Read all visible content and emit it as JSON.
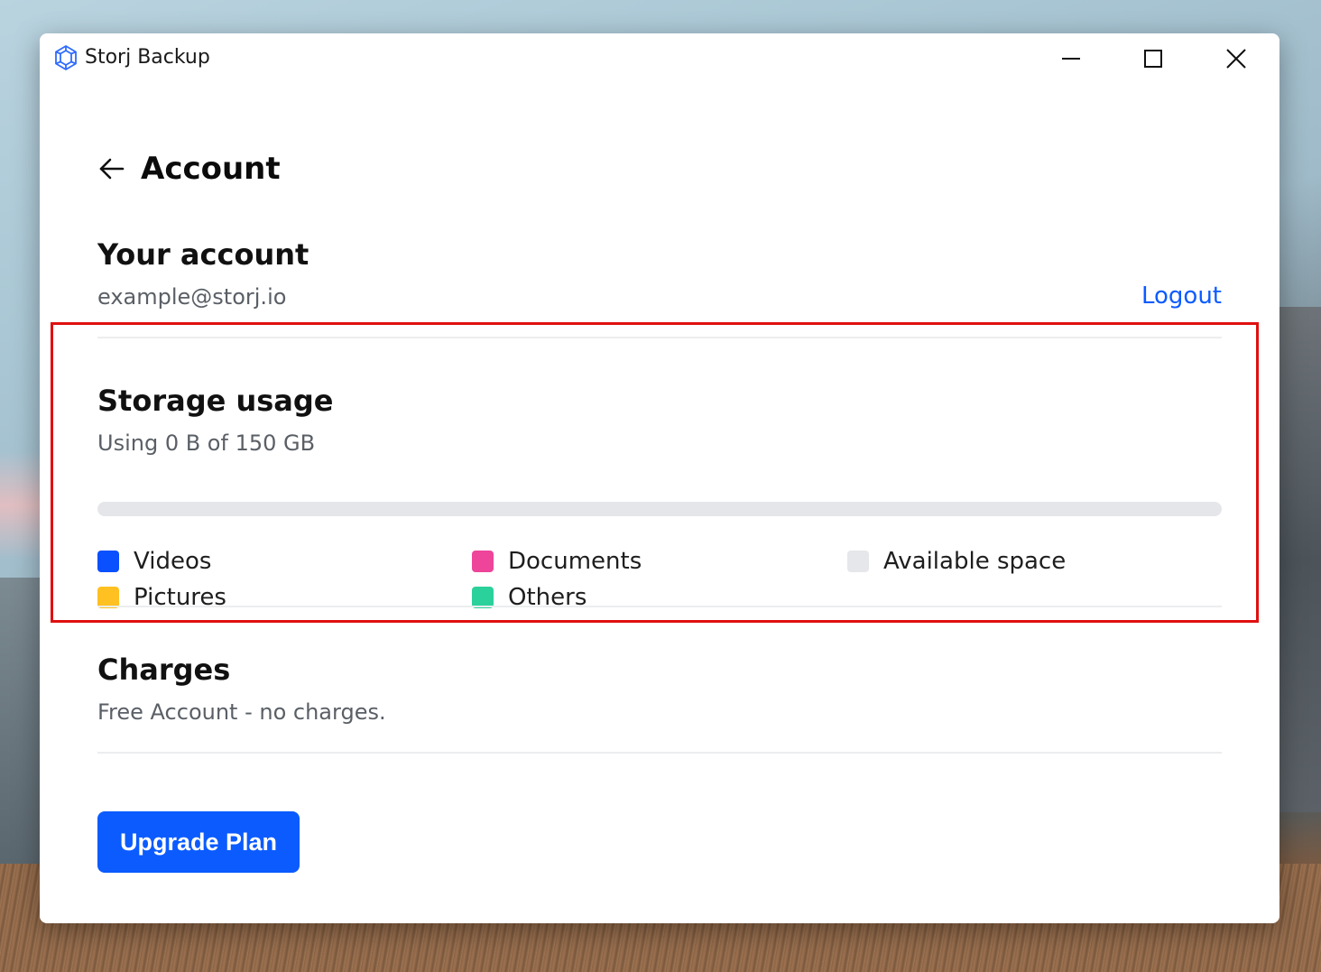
{
  "window": {
    "title": "Storj Backup",
    "minimize_label": "",
    "maximize_label": "",
    "close_label": ""
  },
  "icons": {
    "app": "storj-logo-icon",
    "back": "arrow-left-icon",
    "minimize": "minimize-icon",
    "maximize": "maximize-icon",
    "close": "close-icon"
  },
  "page": {
    "title": "Account"
  },
  "account": {
    "title": "Your account",
    "email": "example@storj.io",
    "logout_label": "Logout"
  },
  "storage": {
    "title": "Storage usage",
    "usage_text": "Using 0 B of 150 GB",
    "used_fraction": 0,
    "legend": [
      {
        "label": "Videos",
        "color": "#0b50ff"
      },
      {
        "label": "Documents",
        "color": "#ee4499"
      },
      {
        "label": "Available space",
        "color": "#e6e7ea"
      },
      {
        "label": "Pictures",
        "color": "#ffc021"
      },
      {
        "label": "Others",
        "color": "#2bd19a"
      }
    ]
  },
  "charges": {
    "title": "Charges",
    "text": "Free Account - no charges."
  },
  "actions": {
    "upgrade_label": "Upgrade Plan"
  },
  "colors": {
    "accent": "#0b5bff",
    "highlight": "#e01010"
  }
}
